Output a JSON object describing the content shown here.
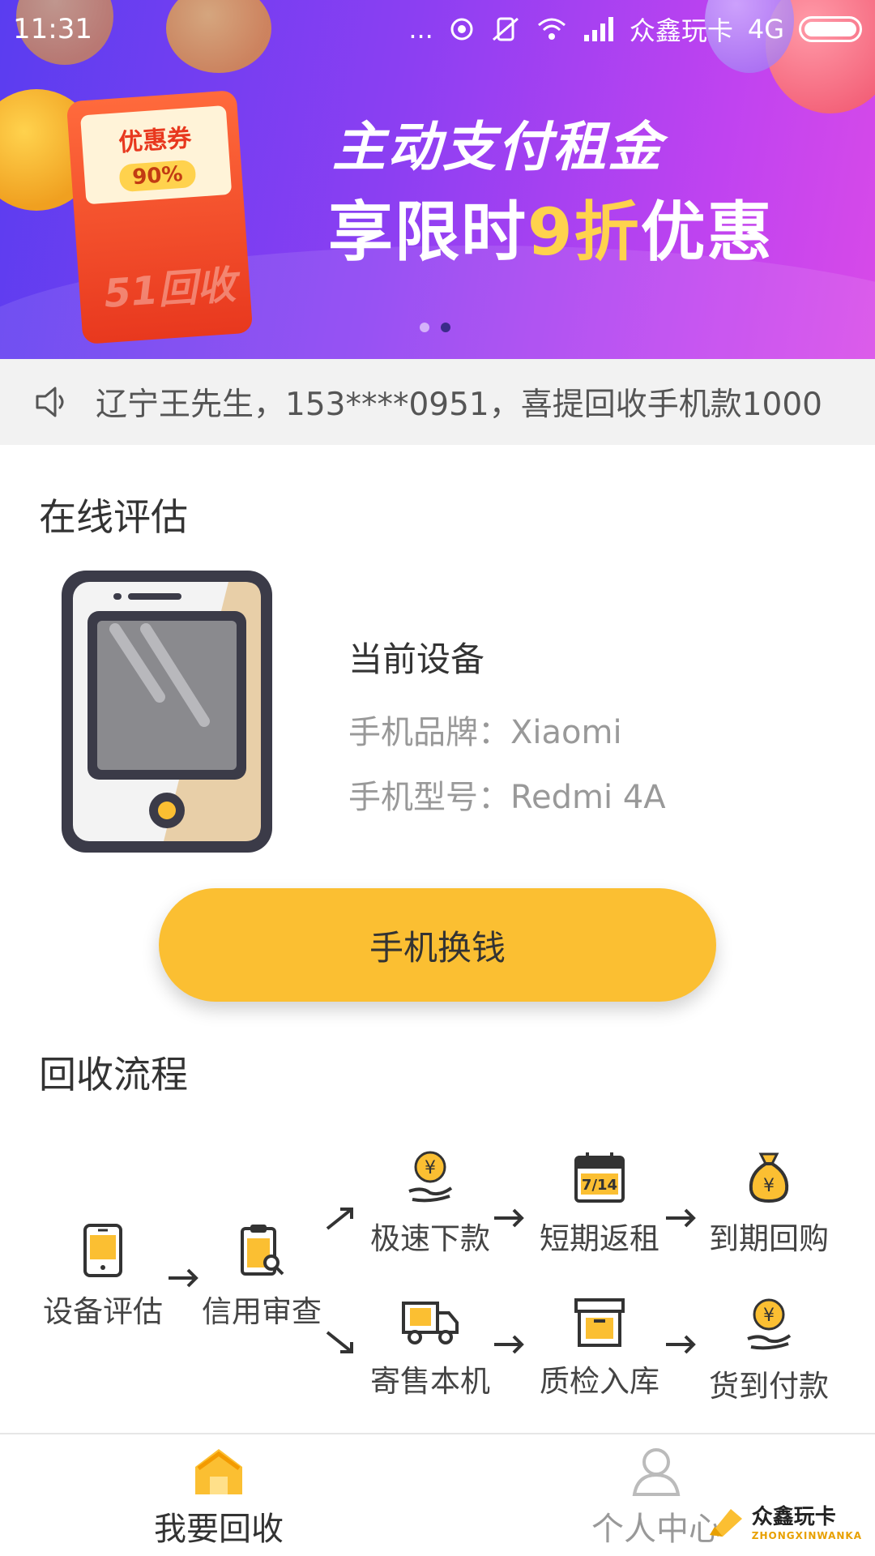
{
  "status_bar": {
    "time": "11:31",
    "dots": "...",
    "carrier": "众鑫玩卡",
    "network": "4G"
  },
  "banner": {
    "coupon_title": "优惠券",
    "coupon_percent": "90%",
    "coupon_brand": "51回收",
    "line1": "主动支付租金",
    "line2_prefix": "享限时",
    "line2_highlight": "9折",
    "line2_suffix": "优惠",
    "slide_count": 2,
    "active_slide": 2,
    "colors": {
      "start": "#5a3df0",
      "end": "#d84ae8",
      "highlight": "#ffd24d"
    }
  },
  "notice": {
    "text": "辽宁王先生，153****0951，喜提回收手机款1000"
  },
  "evaluation": {
    "title": "在线评估",
    "current_device_label": "当前设备",
    "brand_row": "手机品牌：Xiaomi",
    "model_row": "手机型号：Redmi 4A",
    "cta_label": "手机换钱",
    "accent_color": "#fbbf32"
  },
  "process": {
    "title": "回收流程",
    "steps": {
      "evaluate": "设备评估",
      "credit": "信用审查",
      "fast_loan": "极速下款",
      "short_rent": "短期返租",
      "buyback": "到期回购",
      "consign": "寄售本机",
      "inspect": "质检入库",
      "cod": "货到付款"
    },
    "calendar_text": "7/14",
    "yen_symbol": "¥"
  },
  "tabbar": {
    "recycle": "我要回收",
    "profile": "个人中心"
  },
  "watermark": {
    "name": "众鑫玩卡",
    "sub": "ZHONGXINWANKA"
  }
}
